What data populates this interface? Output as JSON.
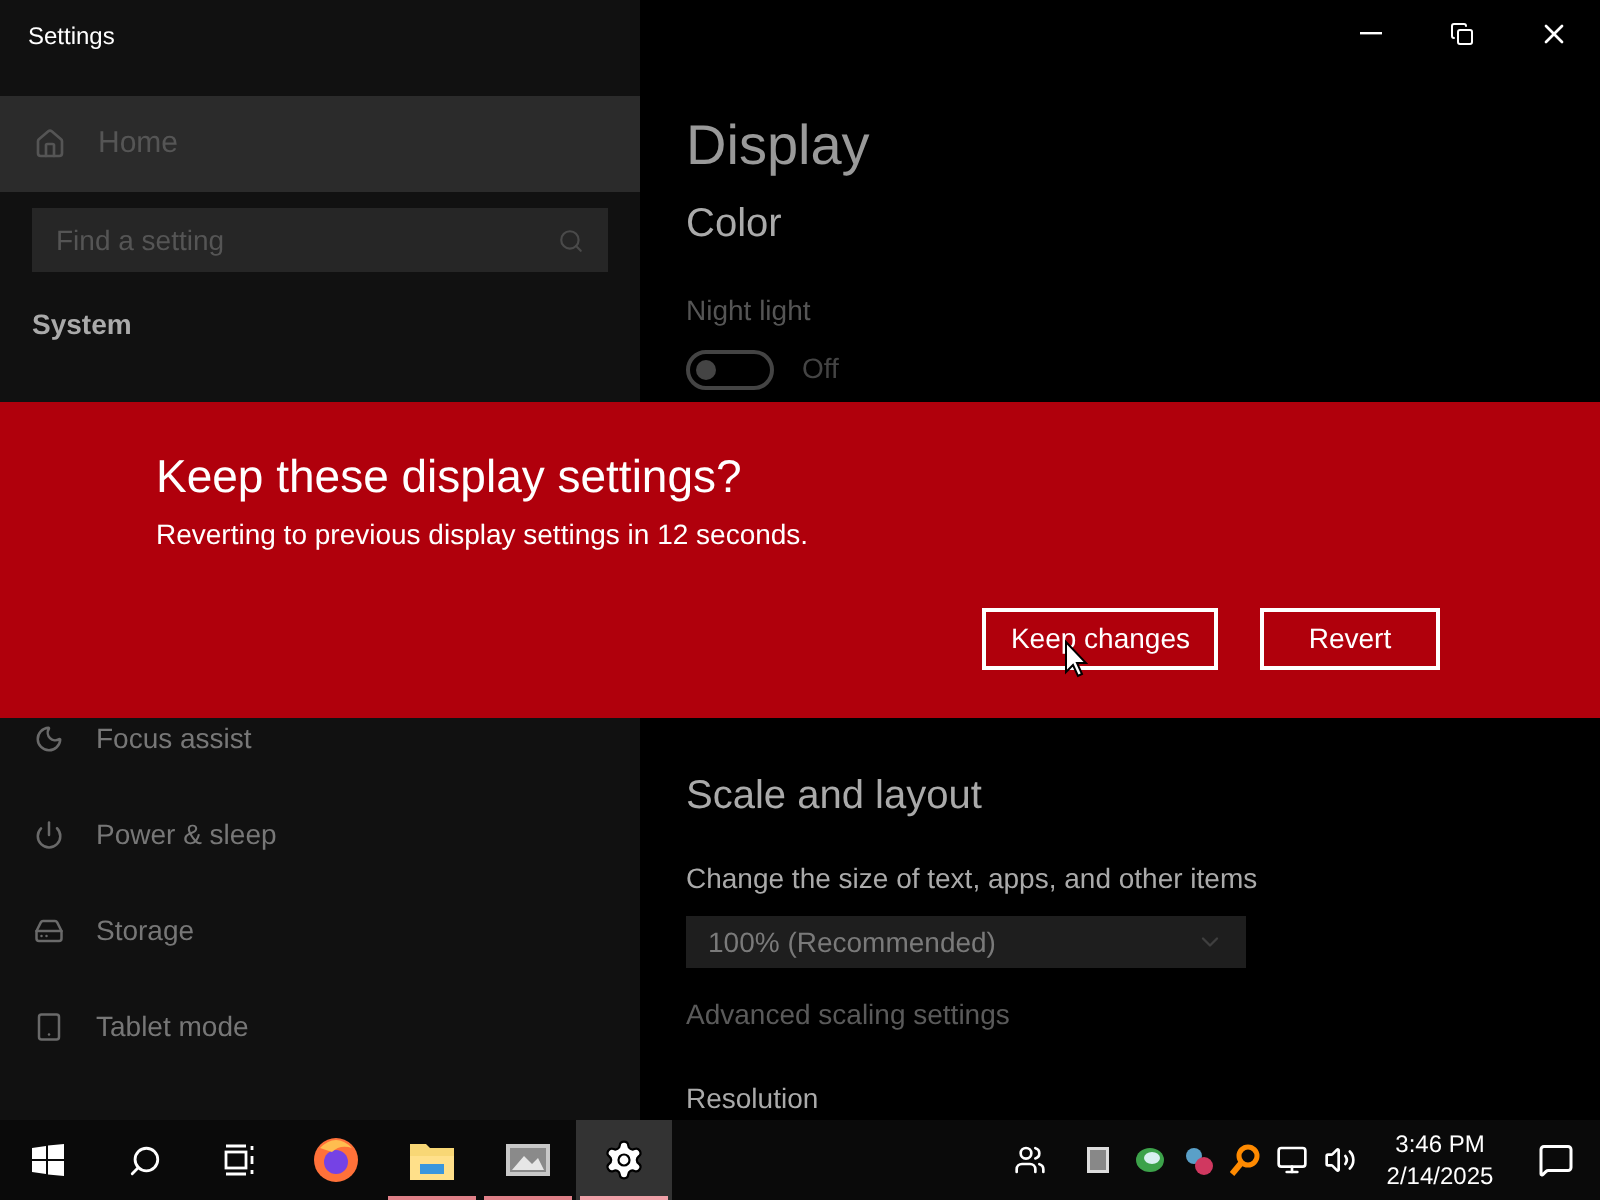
{
  "window": {
    "title": "Settings"
  },
  "sidebar": {
    "home": "Home",
    "search": {
      "placeholder": "Find a setting"
    },
    "section": "System",
    "items": [
      {
        "label": "Focus assist"
      },
      {
        "label": "Power & sleep"
      },
      {
        "label": "Storage"
      },
      {
        "label": "Tablet mode"
      }
    ]
  },
  "content": {
    "title": "Display",
    "color_heading": "Color",
    "night_light": {
      "label": "Night light",
      "on": false,
      "state_text": "Off"
    },
    "scale_heading": "Scale and layout",
    "size_label": "Change the size of text, apps, and other items",
    "size_value": "100% (Recommended)",
    "advanced_link": "Advanced scaling settings",
    "resolution_label": "Resolution"
  },
  "dialog": {
    "title": "Keep these display settings?",
    "message": "Reverting to previous display settings in 12 seconds.",
    "buttons": [
      {
        "label": "Keep changes"
      },
      {
        "label": "Revert"
      }
    ]
  },
  "taskbar": {
    "apps": [
      {
        "running": false,
        "active": false
      },
      {
        "running": true,
        "active": false
      },
      {
        "running": true,
        "active": false
      },
      {
        "running": true,
        "active": true
      }
    ],
    "time": "3:46 PM",
    "date": "2/14/2025"
  }
}
